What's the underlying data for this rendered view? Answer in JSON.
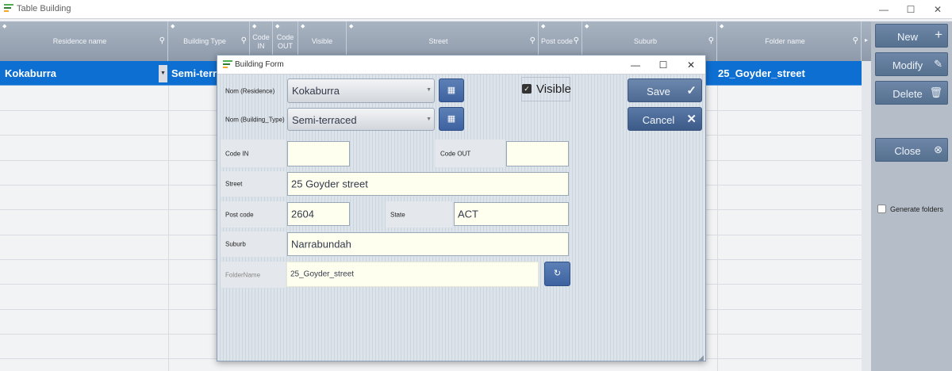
{
  "window": {
    "title": "Table Building",
    "controls": {
      "minimize": "—",
      "maximize": "☐",
      "close": "✕"
    }
  },
  "grid": {
    "columns": [
      {
        "label": "Residence name",
        "searchable": true
      },
      {
        "label": "Building Type",
        "searchable": true
      },
      {
        "label": "Code\nIN",
        "searchable": false
      },
      {
        "label": "Code\nOUT",
        "searchable": false
      },
      {
        "label": "Visible",
        "searchable": false
      },
      {
        "label": "Street",
        "searchable": true
      },
      {
        "label": "Post code",
        "searchable": true
      },
      {
        "label": "Suburb",
        "searchable": true
      },
      {
        "label": "Folder name",
        "searchable": true
      }
    ],
    "selected_row": {
      "residence": "Kokaburra",
      "building_type": "Semi-terrac",
      "folder": "25_Goyder_street"
    }
  },
  "sidebar": {
    "new_label": "New",
    "modify_label": "Modify",
    "delete_label": "Delete",
    "close_label": "Close",
    "generate_folders_label": "Generate folders",
    "generate_folders_checked": false
  },
  "form": {
    "title": "Building Form",
    "controls": {
      "minimize": "—",
      "maximize": "☐",
      "close": "✕"
    },
    "residence_label": "Nom (Residence)",
    "residence_value": "Kokaburra",
    "building_type_label": "Nom (Building_Type)",
    "building_type_value": "Semi-terraced",
    "visible_label": "Visible",
    "visible_checked": true,
    "save_label": "Save",
    "cancel_label": "Cancel",
    "code_in_label": "Code IN",
    "code_in_value": "",
    "code_out_label": "Code OUT",
    "code_out_value": "",
    "street_label": "Street",
    "street_value": "25 Goyder street",
    "post_code_label": "Post code",
    "post_code_value": "2604",
    "state_label": "State",
    "state_value": "ACT",
    "suburb_label": "Suburb",
    "suburb_value": "Narrabundah",
    "folder_label": "FolderName",
    "folder_value": "25_Goyder_street"
  },
  "colors": {
    "selection": "#0e6fd3",
    "button": "#5b79a6",
    "field_bg": "#fffff0"
  }
}
